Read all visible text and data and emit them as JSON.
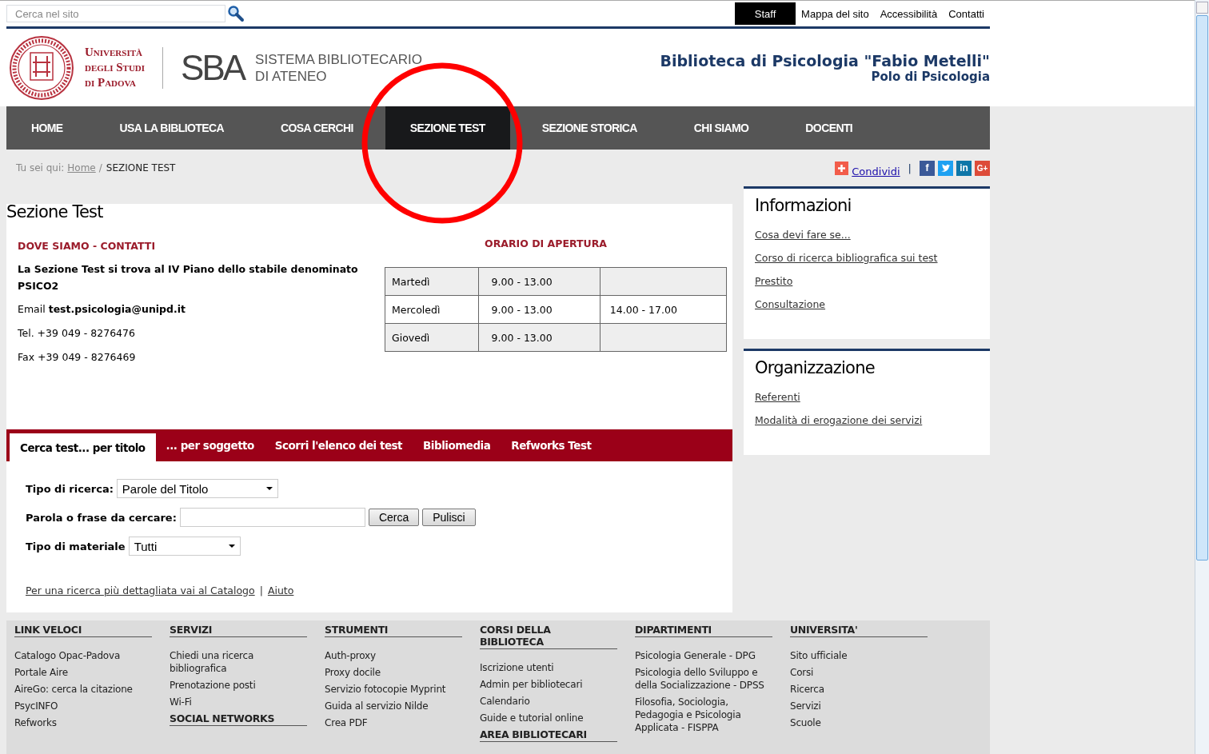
{
  "topbar": {
    "search": {
      "placeholder": "Cerca nel sito"
    },
    "links": [
      {
        "label": "Staff",
        "selected": true
      },
      {
        "label": "Mappa del sito",
        "selected": false
      },
      {
        "label": "Accessibilità",
        "selected": false
      },
      {
        "label": "Contatti",
        "selected": false
      }
    ]
  },
  "header": {
    "university": [
      "Università",
      "degli Studi",
      "di Padova"
    ],
    "sba_mark": "SBA",
    "sba_name": [
      "SISTEMA BIBLIOTECARIO",
      "DI ATENEO"
    ],
    "title": "Biblioteca di Psicologia \"Fabio Metelli\"",
    "subtitle": "Polo di Psicologia"
  },
  "nav": [
    {
      "label": "HOME",
      "selected": false
    },
    {
      "label": "USA LA BIBLIOTECA",
      "selected": false
    },
    {
      "label": "COSA CERCHI",
      "selected": false
    },
    {
      "label": "SEZIONE TEST",
      "selected": true
    },
    {
      "label": "SEZIONE STORICA",
      "selected": false
    },
    {
      "label": "CHI SIAMO",
      "selected": false
    },
    {
      "label": "DOCENTI",
      "selected": false
    }
  ],
  "breadcrumb": {
    "prefix": "Tu sei qui:",
    "home": "Home",
    "separator": "/",
    "current": "SEZIONE TEST"
  },
  "share": {
    "label": "Condividi",
    "separator": "|",
    "social": [
      {
        "kind": "facebook",
        "glyph": "f"
      },
      {
        "kind": "twitter"
      },
      {
        "kind": "linkedin",
        "glyph": "in"
      },
      {
        "kind": "googleplus",
        "glyph": "G+"
      }
    ]
  },
  "main": {
    "title": "Sezione Test",
    "contacts": {
      "heading": "DOVE SIAMO - CONTATTI",
      "location": "La Sezione Test si trova al IV Piano dello stabile denominato PSICO2",
      "lines": [
        "Email **test.psicologia@unipd.it**",
        "Tel. +39 049 - 8276476",
        "Fax +39 049 - 8276469"
      ]
    },
    "hours": {
      "heading": "ORARIO DI APERTURA",
      "rows": [
        [
          "Martedì",
          "9.00 - 13.00",
          ""
        ],
        [
          "Mercoledì",
          "9.00 - 13.00",
          "14.00 - 17.00"
        ],
        [
          "Giovedì",
          "9.00 - 13.00",
          ""
        ]
      ]
    },
    "tabs": [
      {
        "label": "Cerca test... per titolo",
        "selected": true
      },
      {
        "label": "... per soggetto",
        "selected": false
      },
      {
        "label": "Scorri l'elenco dei test",
        "selected": false
      },
      {
        "label": "Bibliomedia",
        "selected": false
      },
      {
        "label": "Refworks Test",
        "selected": false
      }
    ],
    "form": {
      "search_type": {
        "label": "Tipo di ricerca:",
        "value": "Parole del Titolo"
      },
      "query": {
        "label": "Parola o frase da cercare:"
      },
      "buttons": [
        "Cerca",
        "Pulisci"
      ],
      "material": {
        "label": "Tipo di materiale",
        "value": "Tutti"
      }
    },
    "links": [
      "Per una ricerca più dettagliata vai al Catalogo",
      "|",
      "Aiuto"
    ]
  },
  "sidebar": [
    {
      "title": "Informazioni",
      "links": [
        "Cosa devi fare se...",
        "Corso di ricerca bibliografica sui test",
        "Prestito",
        "Consultazione"
      ]
    },
    {
      "title": "Organizzazione",
      "links": [
        "Referenti",
        "Modalità di erogazione dei servizi"
      ]
    }
  ],
  "footer": [
    {
      "sections": [
        {
          "heading": "LINK VELOCI",
          "links": [
            "Catalogo Opac-Padova",
            "Portale Aire",
            "AireGo: cerca la citazione",
            "PsycINFO",
            "Refworks"
          ]
        }
      ]
    },
    {
      "sections": [
        {
          "heading": "SERVIZI",
          "links": [
            "Chiedi una ricerca bibliografica",
            "Prenotazione posti",
            "Wi-Fi"
          ]
        },
        {
          "heading": "SOCIAL NETWORKS"
        }
      ]
    },
    {
      "sections": [
        {
          "heading": "STRUMENTI",
          "links": [
            "Auth-proxy",
            "Proxy docile",
            "Servizio fotocopie Myprint",
            "Guida al servizio Nilde",
            "Crea PDF"
          ]
        }
      ]
    },
    {
      "sections": [
        {
          "heading": "CORSI DELLA BIBLIOTECA",
          "links": [
            "Iscrizione utenti",
            "Admin per bibliotecari",
            "Calendario",
            "Guide e tutorial online"
          ]
        },
        {
          "heading": "AREA BIBLIOTECARI"
        }
      ]
    },
    {
      "sections": [
        {
          "heading": "DIPARTIMENTI",
          "links": [
            "Psicologia Generale - DPG",
            "Psicologia dello Sviluppo e della Socializzazione - DPSS",
            "Filosofia, Sociologia, Pedagogia e Psicologia Applicata - FISPPA"
          ]
        }
      ]
    },
    {
      "sections": [
        {
          "heading": "UNIVERSITA'",
          "links": [
            "Sito ufficiale",
            "Corsi",
            "Ricerca",
            "Servizi",
            "Scuole"
          ]
        }
      ]
    }
  ]
}
